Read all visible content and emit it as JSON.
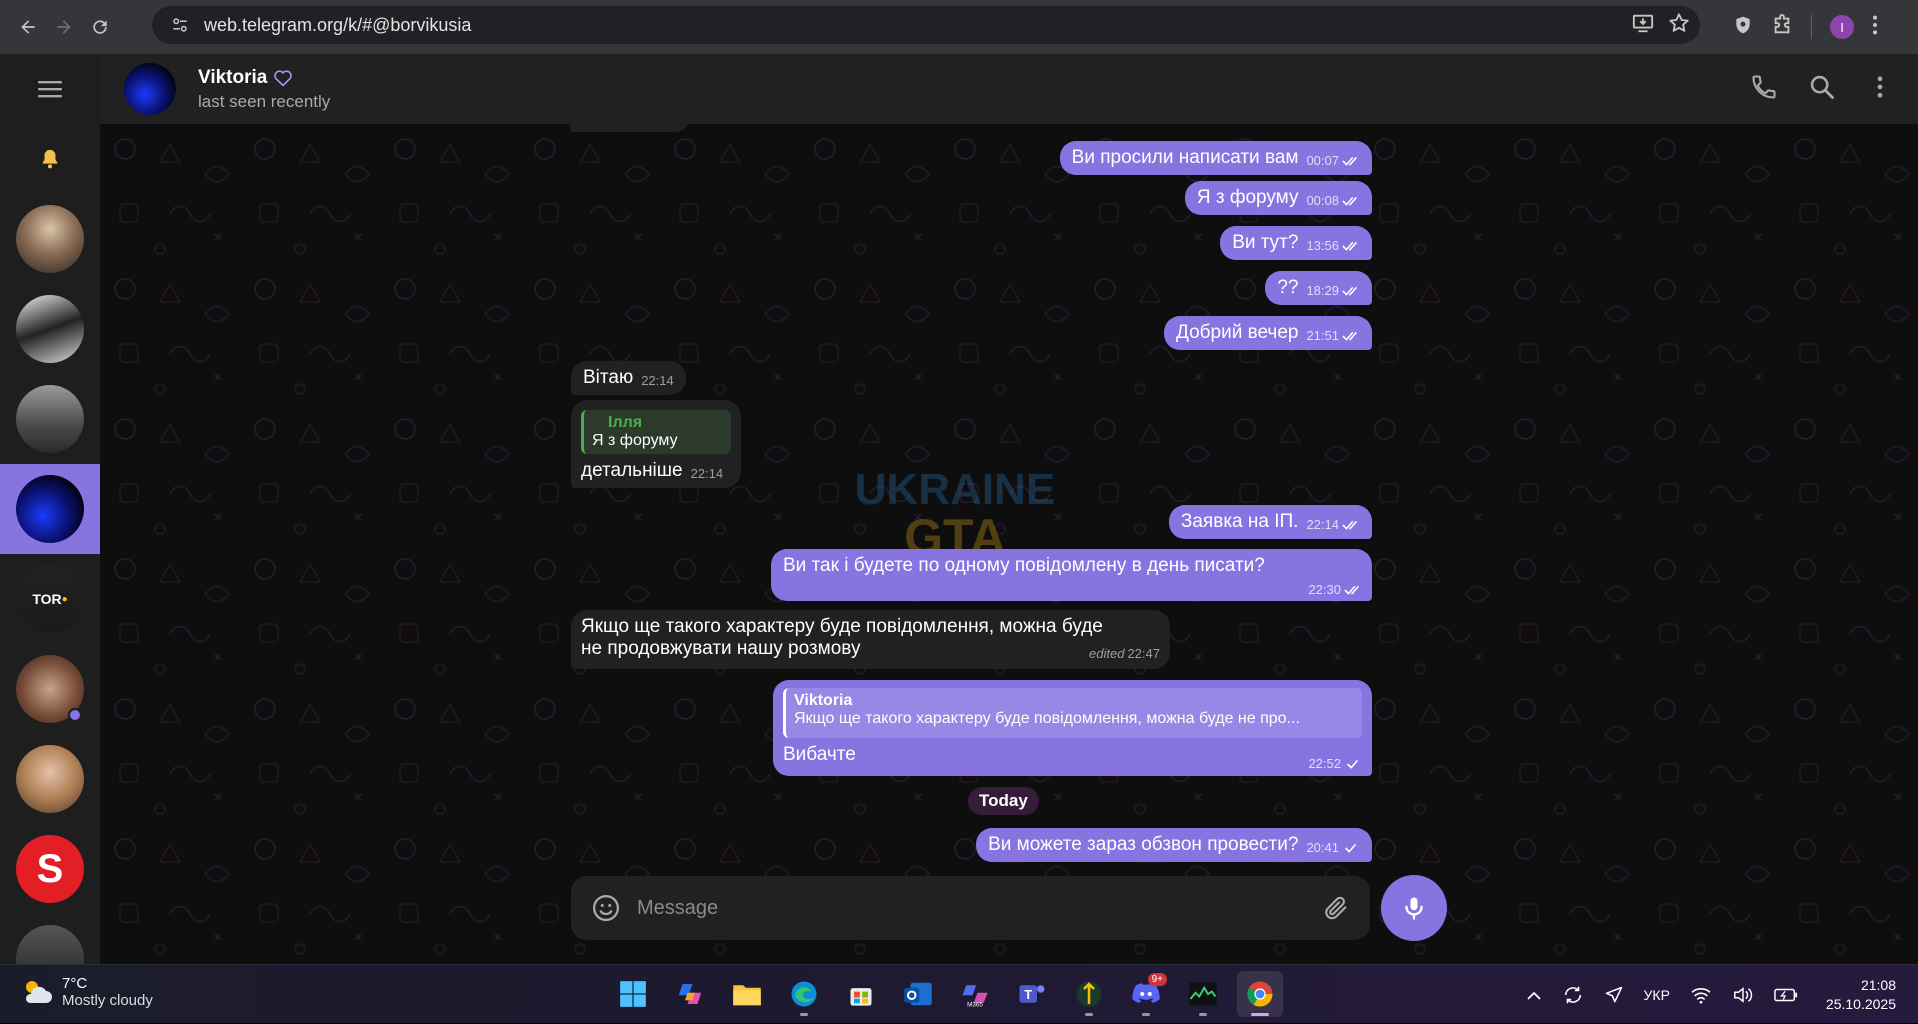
{
  "browser": {
    "url": "web.telegram.org/k/#@borvikusia",
    "profile_initial": "I"
  },
  "chat": {
    "name": "Viktoria",
    "status": "last seen recently",
    "composer_placeholder": "Message",
    "messages": [
      {
        "dir": "out",
        "text": "Ви просили написати вам",
        "time": "00:07",
        "ticks": 2
      },
      {
        "dir": "out",
        "text": "Я з форуму",
        "time": "00:08",
        "ticks": 2
      },
      {
        "dir": "out",
        "text": "Ви тут?",
        "time": "13:56",
        "ticks": 2
      },
      {
        "dir": "out",
        "text": "??",
        "time": "18:29",
        "ticks": 2
      },
      {
        "dir": "out",
        "text": "Добрий вечер",
        "time": "21:51",
        "ticks": 2
      },
      {
        "dir": "in",
        "text": "Вітаю",
        "time": "22:14"
      },
      {
        "dir": "in",
        "reply_name": "Ілля",
        "reply_text": "Я з форуму",
        "text": "детальніше",
        "time": "22:14"
      },
      {
        "dir": "out",
        "text": "Заявка на ІП.",
        "time": "22:14",
        "ticks": 2
      },
      {
        "dir": "out",
        "text": "Ви так і будете по одному повідомлену в день писати?",
        "time": "22:30",
        "ticks": 2
      },
      {
        "dir": "in",
        "text_line1": "Якщо ще такого характеру буде повідомлення, можна буде",
        "text_line2": "не продовжувати нашу розмову",
        "edited": "edited",
        "time": "22:47"
      },
      {
        "dir": "out",
        "reply_name": "Viktoria",
        "reply_text": "Якщо ще такого характеру буде повідомлення, можна буде не про...",
        "text": "Вибачте",
        "time": "22:52",
        "ticks": 1
      },
      {
        "dir": "out",
        "text": "Ви можете зараз обзвон провести?",
        "time": "20:41",
        "ticks": 1
      }
    ],
    "day_separator": "Today"
  },
  "taskbar": {
    "weather_temp": "7°C",
    "weather_condition": "Mostly cloudy",
    "discord_badge": "9+",
    "language": "УКР",
    "time": "21:08",
    "date": "25.10.2025"
  },
  "colors": {
    "accent": "#8774e1",
    "incoming_bubble": "#212121",
    "header_bg": "#212121",
    "reply_green": "#4fae4e"
  }
}
